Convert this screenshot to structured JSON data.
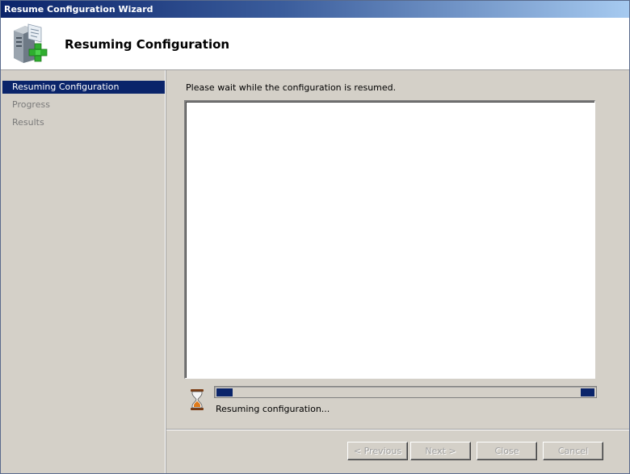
{
  "window": {
    "title": "Resume Configuration Wizard"
  },
  "header": {
    "title": "Resuming Configuration",
    "icon": "server-add-icon"
  },
  "sidebar": {
    "items": [
      {
        "label": "Resuming Configuration",
        "state": "active"
      },
      {
        "label": "Progress",
        "state": "inactive"
      },
      {
        "label": "Results",
        "state": "inactive"
      }
    ]
  },
  "main": {
    "instruction": "Please wait while the configuration is resumed.",
    "log_content": "",
    "status": "Resuming configuration...",
    "progress": {
      "style": "marquee",
      "colors": {
        "fill": "#0a246a"
      }
    }
  },
  "buttons": {
    "previous": "< Previous",
    "next": "Next >",
    "close": "Close",
    "cancel": "Cancel",
    "enabled": false
  },
  "colors": {
    "accent": "#0a246a",
    "titlebar_start": "#0b246a",
    "titlebar_end": "#a6caf0",
    "background": "#d4d0c8"
  }
}
